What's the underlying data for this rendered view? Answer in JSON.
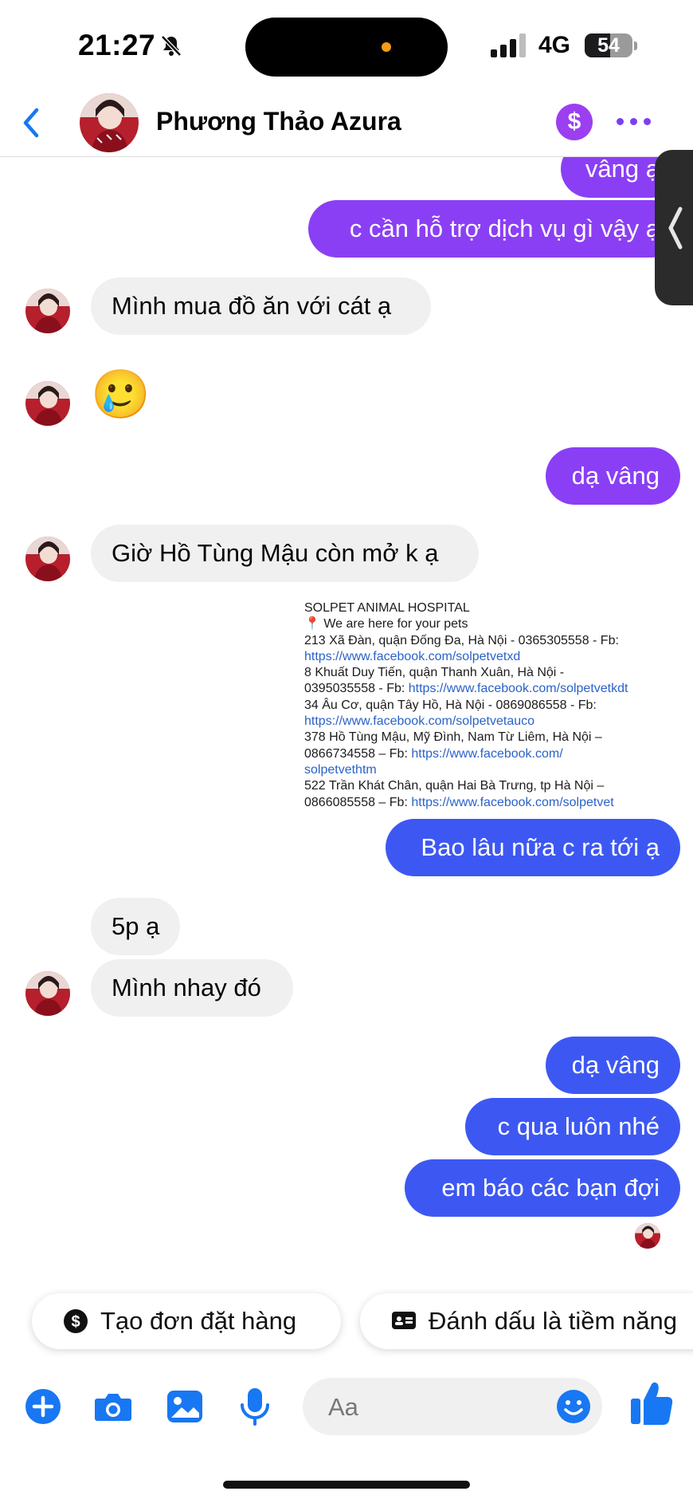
{
  "status_bar": {
    "time": "21:27",
    "network": "4G",
    "battery": "54",
    "battery_level": 0.54
  },
  "header": {
    "contact_name": "Phương Thảo Azura",
    "dollar_symbol": "$"
  },
  "messages": [
    {
      "dir": "out",
      "text": "vâng ạ"
    },
    {
      "dir": "out",
      "text": "c cần hỗ trợ dịch vụ gì vậy ạ"
    },
    {
      "dir": "in",
      "text": "Mình mua đồ ăn với cát ạ"
    },
    {
      "dir": "in",
      "text": "🥲",
      "emoji": "sad-smile-tear"
    },
    {
      "dir": "out",
      "text": "dạ vâng"
    },
    {
      "dir": "in",
      "text": "Giờ Hồ Tùng Mậu còn mở k ạ"
    },
    {
      "dir": "out",
      "text": "Bao lâu nữa c ra tới ạ"
    },
    {
      "dir": "in",
      "text": "5p ạ"
    },
    {
      "dir": "in",
      "text": "Mình nhay đó"
    },
    {
      "dir": "out",
      "text": "dạ vâng"
    },
    {
      "dir": "out",
      "text": "c qua luôn nhé"
    },
    {
      "dir": "out",
      "text": "em báo các bạn đợi"
    }
  ],
  "hospital_info": {
    "lines": [
      {
        "text": "SOLPET ANIMAL HOSPITAL",
        "link": ""
      },
      {
        "text": "📍 We are here for your pets",
        "link": ""
      },
      {
        "text": "213 Xã Đàn, quận Đống Đa, Hà Nội - 0365305558 - Fb:",
        "link": ""
      },
      {
        "text": "",
        "link": "https://www.facebook.com/solpetvetxd"
      },
      {
        "text": "8 Khuất Duy Tiến, quận Thanh Xuân, Hà Nội -",
        "link": ""
      },
      {
        "text": "0395035558 - Fb: ",
        "link": "https://www.facebook.com/solpetvetkdt"
      },
      {
        "text": "34 Âu Cơ, quận Tây Hồ, Hà Nội - 0869086558 - Fb:",
        "link": ""
      },
      {
        "text": "",
        "link": "https://www.facebook.com/solpetvetauco"
      },
      {
        "text": "378 Hồ Tùng Mậu, Mỹ Đình, Nam Từ Liêm, Hà Nội –",
        "link": ""
      },
      {
        "text": "0866734558 – Fb: ",
        "link": "https://www.facebook.com/"
      },
      {
        "text": "",
        "link": "solpetvethtm"
      },
      {
        "text": "522 Trần Khát Chân, quận Hai Bà Trưng, tp Hà Nội –",
        "link": ""
      },
      {
        "text": "0866085558 – Fb: ",
        "link": "https://www.facebook.com/solpetvet"
      }
    ]
  },
  "quick_actions": [
    {
      "label": "Tạo đơn đặt hàng",
      "icon": "dollar-circle-icon"
    },
    {
      "label": "Đánh dấu là tiềm năng",
      "icon": "id-card-icon"
    }
  ],
  "composer": {
    "placeholder": "Aa"
  },
  "colors": {
    "outgoing_purple": "#8a3ff5",
    "outgoing_blue": "#3d58f2",
    "incoming": "#f0f0f0",
    "accent": "#1877f2"
  }
}
